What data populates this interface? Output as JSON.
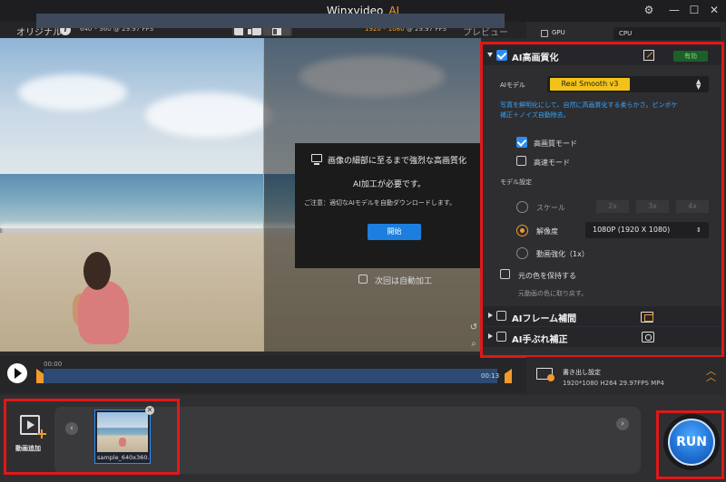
{
  "window": {
    "title": "Winxvideo",
    "title_suffix": "AI",
    "controls": {
      "settings": "⚙",
      "minimize": "—",
      "maximize": "☐",
      "close": "✕"
    }
  },
  "preview_header": {
    "original_label": "オリジナル",
    "info": "i",
    "source_res": "640 * 360 @ 29.97 FPS",
    "output_res_highlight": "1920 * 1080",
    "output_res_rest": " @ 29.97 FPS",
    "preview_label": "プレビュー"
  },
  "modal": {
    "title": "画像の細部に至るまで強烈な高画質化",
    "requirement": "AI加工が必要です。",
    "note": "ご注意：適切なAIモデルを自動ダウンロードします。",
    "start_button": "開始",
    "auto_label": "次回は自動加工"
  },
  "playback": {
    "time_start": "00:00",
    "time_end": "00:13",
    "progress": 0.0
  },
  "hardware": {
    "gpu_label": "GPU",
    "gpu_checked": false,
    "processor": "CPU"
  },
  "enhance": {
    "title": "AI高画質化",
    "enabled_badge": "有効",
    "model_label": "AIモデル",
    "model_value": "Real Smooth v3",
    "description_line1": "写真を鮮明化にして、自然に高画質化する柔らかさ。ピンボケ",
    "description_line2": "補正＋ノイズ自動除去。",
    "hq_mode": "高画質モード",
    "hq_checked": true,
    "fast_mode": "高速モード",
    "fast_checked": false,
    "model_settings": "モデル設定",
    "scale_label": "スケール",
    "scale_options": [
      "2x",
      "3x",
      "4x"
    ],
    "resolution_label": "解像度",
    "resolution_value": "1080P (1920 X 1080)",
    "video_enhance_label": "動画強化（1x）",
    "keep_color_label": "元の色を保持する",
    "keep_color_note": "元動画の色に取り戻す。"
  },
  "frame_interp": {
    "title": "AIフレーム補間"
  },
  "stabilize": {
    "title": "AI手ぶれ補正"
  },
  "export": {
    "title": "書き出し設定",
    "meta": "1920*1080  H264  29.97FPS  MP4"
  },
  "media": {
    "add_label": "動画追加",
    "file_name": "sample_640x360.",
    "prev": "‹",
    "next": "›",
    "close": "✕"
  },
  "run_label": "RUN",
  "colors": {
    "accent": "#f39a2b",
    "blue": "#2d8cf0",
    "highlight_frame": "#e01818"
  }
}
